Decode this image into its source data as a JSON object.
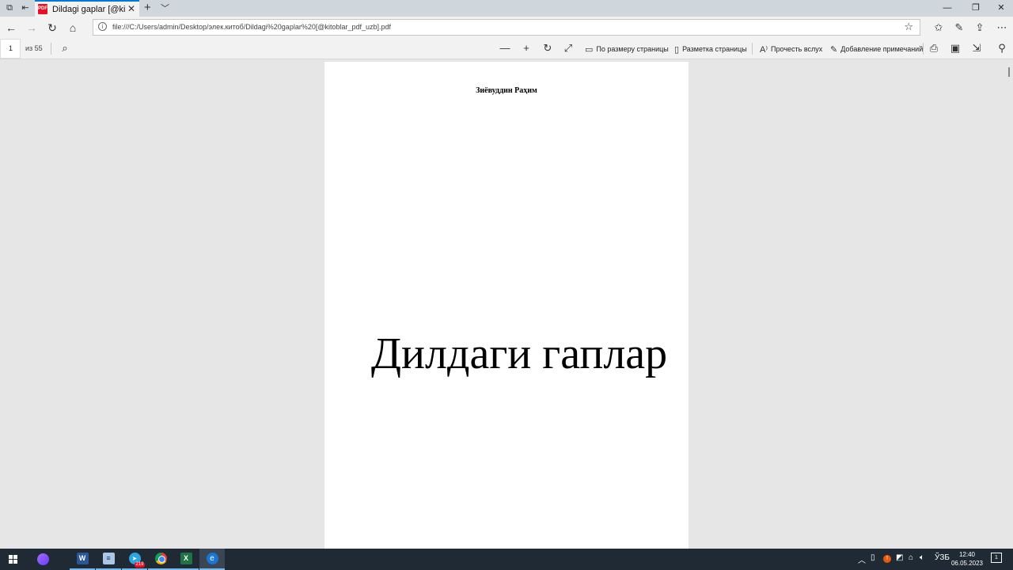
{
  "browser": {
    "tab": {
      "title": "Dildagi gaplar [@kitoblar_pdf_uzb]",
      "close": "✕"
    },
    "new_tab": "+",
    "window": {
      "minimize": "—",
      "restore": "❐",
      "close": "✕"
    },
    "address": {
      "url": "file:///C:/Users/admin/Desktop/элек.китоб/Dildagi%20gaplar%20[@kitoblar_pdf_uzb].pdf"
    }
  },
  "pdf_toolbar": {
    "current_page": "1",
    "page_count": "из 55",
    "fit_page": "По размеру страницы",
    "page_layout": "Разметка страницы",
    "read_aloud": "Прочесть вслух",
    "add_notes": "Добавление примечаний"
  },
  "document": {
    "author": "Зиёвуддин Раҳим",
    "title": "Дилдаги гаплар"
  },
  "taskbar": {
    "telegram_badge": "219",
    "language": "ЎЗБ",
    "time": "12:40",
    "date": "06.05.2023",
    "notification_count": "1"
  },
  "colors": {
    "accent": "#0078d7",
    "taskbar": "#1f2a35",
    "pdf_icon": "#e81123"
  }
}
